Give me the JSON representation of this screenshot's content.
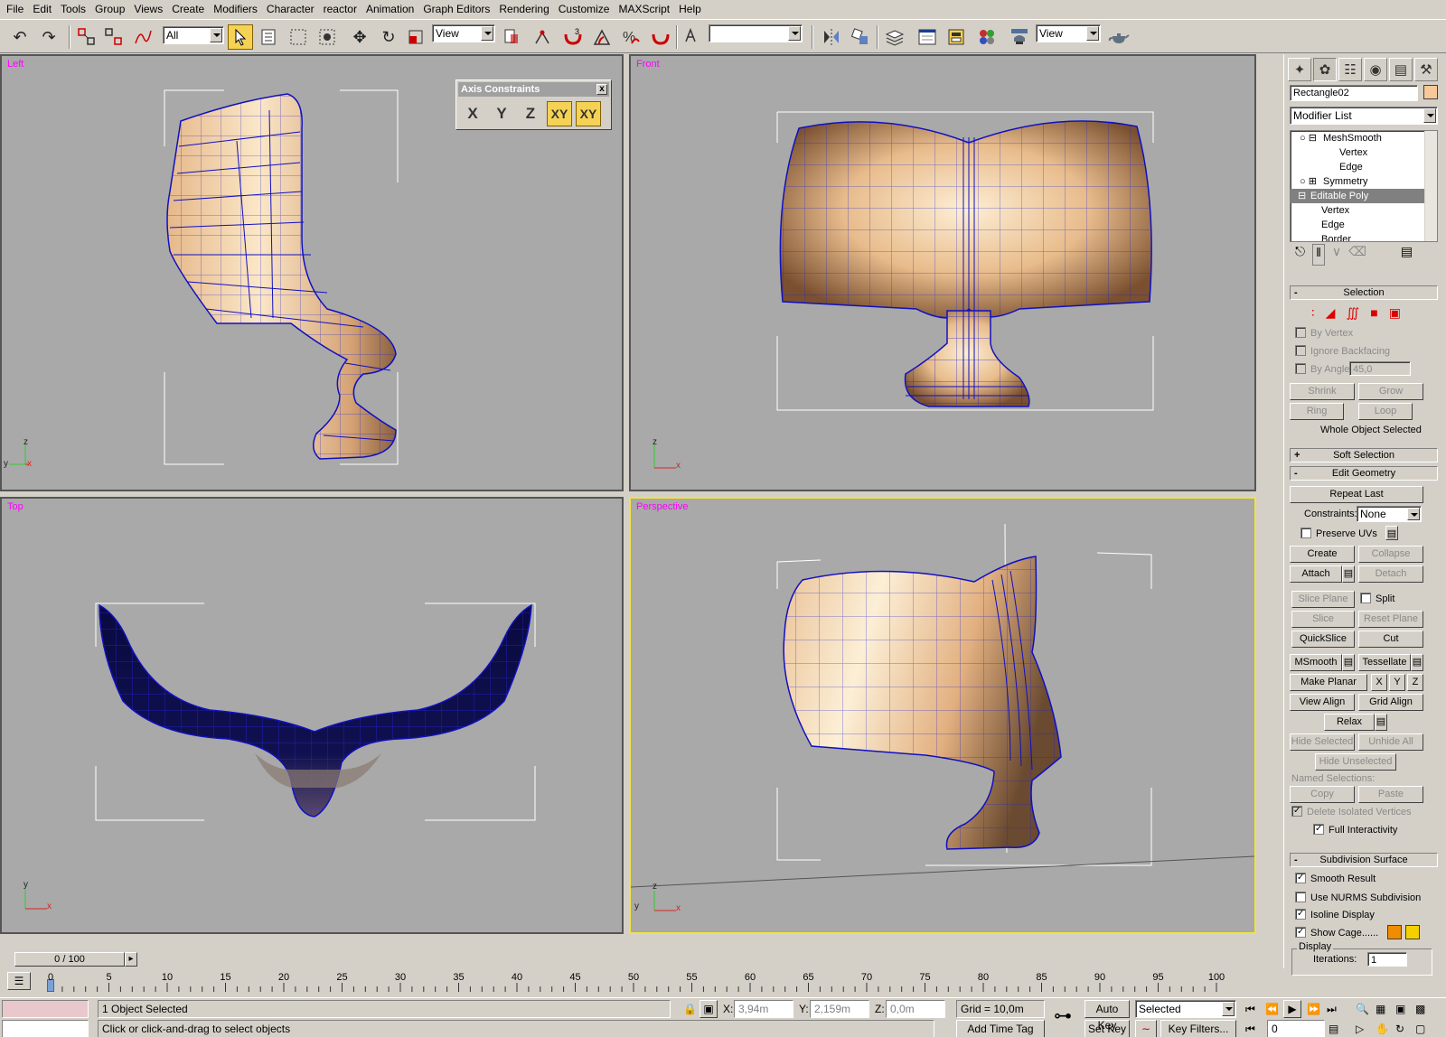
{
  "menu": [
    "File",
    "Edit",
    "Tools",
    "Group",
    "Views",
    "Create",
    "Modifiers",
    "Character",
    "reactor",
    "Animation",
    "Graph Editors",
    "Rendering",
    "Customize",
    "MAXScript",
    "Help"
  ],
  "toolbar": {
    "selection_filter": "All",
    "ref_coord": "View",
    "named_sel": "",
    "view_combo": "View"
  },
  "viewports": {
    "left": "Left",
    "front": "Front",
    "top": "Top",
    "perspective": "Perspective"
  },
  "axis_constraints": {
    "title": "Axis Constraints",
    "close": "x",
    "buttons": [
      "X",
      "Y",
      "Z",
      "XY",
      "XY"
    ]
  },
  "axis_labels": {
    "x": "x",
    "y": "y",
    "z": "z"
  },
  "command_panel": {
    "object_name": "Rectangle02",
    "modifier_list": "Modifier List",
    "stack": [
      "MeshSmooth",
      "Vertex",
      "Edge",
      "Symmetry",
      "Editable Poly",
      "Vertex",
      "Edge",
      "Border"
    ],
    "selection": {
      "header": "Selection",
      "by_vertex": "By Vertex",
      "ignore_backfacing": "Ignore Backfacing",
      "by_angle": "By Angle:",
      "angle_value": "45,0",
      "shrink": "Shrink",
      "grow": "Grow",
      "ring": "Ring",
      "loop": "Loop",
      "status": "Whole Object Selected"
    },
    "soft_selection": "Soft Selection",
    "edit_geometry": {
      "header": "Edit Geometry",
      "repeat_last": "Repeat Last",
      "constraints_label": "Constraints:",
      "constraints_value": "None",
      "preserve_uvs": "Preserve UVs",
      "create": "Create",
      "collapse": "Collapse",
      "attach": "Attach",
      "detach": "Detach",
      "slice_plane": "Slice Plane",
      "split": "Split",
      "slice": "Slice",
      "reset_plane": "Reset Plane",
      "quickslice": "QuickSlice",
      "cut": "Cut",
      "msmooth": "MSmooth",
      "tessellate": "Tessellate",
      "make_planar": "Make Planar",
      "x": "X",
      "y": "Y",
      "z": "Z",
      "view_align": "View Align",
      "grid_align": "Grid Align",
      "relax": "Relax",
      "hide_selected": "Hide Selected",
      "unhide_all": "Unhide All",
      "hide_unselected": "Hide Unselected",
      "named_selections": "Named Selections:",
      "copy": "Copy",
      "paste": "Paste",
      "delete_isolated": "Delete Isolated Vertices",
      "full_interactivity": "Full Interactivity"
    },
    "subdivision": {
      "header": "Subdivision Surface",
      "smooth_result": "Smooth Result",
      "use_nurms": "Use NURMS Subdivision",
      "isoline_display": "Isoline Display",
      "show_cage": "Show Cage......",
      "display_group": "Display",
      "iterations_label": "Iterations:",
      "iterations_value": "1"
    },
    "colors": {
      "cage1": "#f08c00",
      "cage2": "#f5d000",
      "object_color": "#f9c89a"
    }
  },
  "timeline": {
    "slider": "0 / 100",
    "ticks": [
      0,
      5,
      10,
      15,
      20,
      25,
      30,
      35,
      40,
      45,
      50,
      55,
      60,
      65,
      70,
      75,
      80,
      85,
      90,
      95,
      100
    ]
  },
  "status": {
    "selected": "1 Object Selected",
    "prompt": "Click or click-and-drag to select objects",
    "x_label": "X:",
    "x_value": "3,94m",
    "y_label": "Y:",
    "y_value": "2,159m",
    "z_label": "Z:",
    "z_value": "0,0m",
    "grid": "Grid = 10,0m",
    "add_time_tag": "Add Time Tag",
    "auto_key": "Auto Key",
    "set_key": "Set Key",
    "key_mode": "Selected",
    "key_filters": "Key Filters...",
    "frame": "0"
  }
}
